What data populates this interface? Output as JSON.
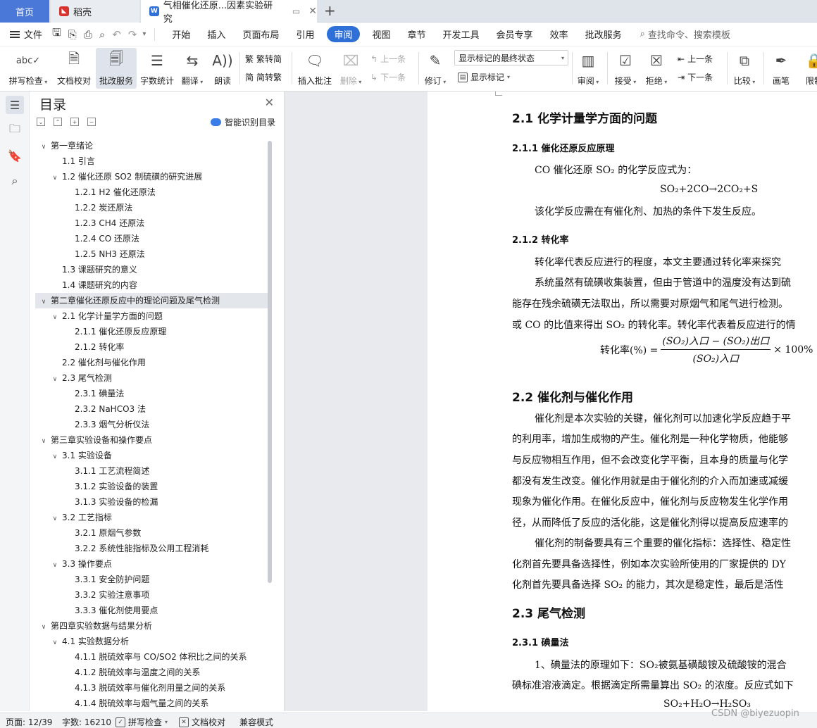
{
  "tabs": {
    "home": "首页",
    "daoke": "稻壳",
    "document": "气相催化还原...因素实验研究"
  },
  "menu": {
    "file": "文件",
    "items": [
      "开始",
      "插入",
      "页面布局",
      "引用",
      "审阅",
      "视图",
      "章节",
      "开发工具",
      "会员专享",
      "效率",
      "批改服务"
    ],
    "active_index": 4,
    "search": "查找命令、搜索模板"
  },
  "ribbon": {
    "spell_check": "拼写检查",
    "doc_proofread": "文档校对",
    "grading": "批改服务",
    "word_count": "字数统计",
    "translate": "翻译",
    "read_aloud": "朗读",
    "trad_to_simp": "繁转简",
    "simp_to_trad": "简转繁",
    "insert_comment": "插入批注",
    "delete": "删除",
    "prev_comment": "上一条",
    "next_comment": "下一条",
    "revise": "修订",
    "markup_state": "显示标记的最终状态",
    "show_markup": "显示标记",
    "review": "审阅",
    "accept": "接受",
    "reject": "拒绝",
    "prev_change": "上一条",
    "next_change": "下一条",
    "compare": "比较",
    "pen": "画笔",
    "restrict": "限制"
  },
  "toc": {
    "title": "目录",
    "smart_detect": "智能识别目录",
    "items": [
      {
        "text": "第一章绪论",
        "level": 0,
        "toggle": "expanded"
      },
      {
        "text": "1.1  引言",
        "level": 1,
        "toggle": "none"
      },
      {
        "text": "1.2  催化还原 SO2 制硫磺的研究进展",
        "level": 1,
        "toggle": "expanded"
      },
      {
        "text": "1.2.1 H2 催化还原法",
        "level": 2,
        "toggle": "none"
      },
      {
        "text": "1.2.2  炭还原法",
        "level": 2,
        "toggle": "none"
      },
      {
        "text": "1.2.3 CH4 还原法",
        "level": 2,
        "toggle": "none"
      },
      {
        "text": "1.2.4 CO 还原法",
        "level": 2,
        "toggle": "none"
      },
      {
        "text": "1.2.5 NH3 还原法",
        "level": 2,
        "toggle": "none"
      },
      {
        "text": "1.3  课题研究的意义",
        "level": 1,
        "toggle": "none"
      },
      {
        "text": "1.4  课题研究的内容",
        "level": 1,
        "toggle": "none"
      },
      {
        "text": "第二章催化还原反应中的理论问题及尾气检测",
        "level": 0,
        "toggle": "expanded",
        "selected": true
      },
      {
        "text": "2.1  化学计量学方面的问题",
        "level": 1,
        "toggle": "expanded"
      },
      {
        "text": "2.1.1  催化还原反应原理",
        "level": 2,
        "toggle": "none"
      },
      {
        "text": "2.1.2  转化率",
        "level": 2,
        "toggle": "none"
      },
      {
        "text": "2.2 催化剂与催化作用",
        "level": 1,
        "toggle": "none"
      },
      {
        "text": "2.3  尾气检测",
        "level": 1,
        "toggle": "expanded"
      },
      {
        "text": "2.3.1  碘量法",
        "level": 2,
        "toggle": "none"
      },
      {
        "text": "2.3.2 NaHCO3 法",
        "level": 2,
        "toggle": "none"
      },
      {
        "text": "2.3.3  烟气分析仪法",
        "level": 2,
        "toggle": "none"
      },
      {
        "text": "第三章实验设备和操作要点",
        "level": 0,
        "toggle": "expanded"
      },
      {
        "text": "3.1  实验设备",
        "level": 1,
        "toggle": "expanded"
      },
      {
        "text": "3.1.1  工艺流程简述",
        "level": 2,
        "toggle": "none"
      },
      {
        "text": "3.1.2  实验设备的装置",
        "level": 2,
        "toggle": "none"
      },
      {
        "text": "3.1.3  实验设备的检漏",
        "level": 2,
        "toggle": "none"
      },
      {
        "text": "3.2  工艺指标",
        "level": 1,
        "toggle": "expanded"
      },
      {
        "text": "3.2.1  原烟气参数",
        "level": 2,
        "toggle": "none"
      },
      {
        "text": "3.2.2  系统性能指标及公用工程消耗",
        "level": 2,
        "toggle": "none"
      },
      {
        "text": "3.3  操作要点",
        "level": 1,
        "toggle": "expanded"
      },
      {
        "text": "3.3.1  安全防护问题",
        "level": 2,
        "toggle": "none"
      },
      {
        "text": "3.3.2  实验注意事项",
        "level": 2,
        "toggle": "none"
      },
      {
        "text": "3.3.3  催化剂使用要点",
        "level": 2,
        "toggle": "none"
      },
      {
        "text": "第四章实验数据与结果分析",
        "level": 0,
        "toggle": "expanded"
      },
      {
        "text": "4.1  实验数据分析",
        "level": 1,
        "toggle": "expanded"
      },
      {
        "text": "4.1.1  脱硫效率与 CO/SO2 体积比之间的关系",
        "level": 2,
        "toggle": "none"
      },
      {
        "text": "4.1.2  脱硫效率与温度之间的关系",
        "level": 2,
        "toggle": "none"
      },
      {
        "text": "4.1.3  脱硫效率与催化剂用量之间的关系",
        "level": 2,
        "toggle": "none"
      },
      {
        "text": "4.1.4  脱硫效率与烟气量之间的关系",
        "level": 2,
        "toggle": "none"
      }
    ]
  },
  "doc": {
    "h_2_1": "2.1  化学计量学方面的问题",
    "h_2_1_1": "2.1.1  催化还原反应原理",
    "p1": "CO 催化还原 SO₂ 的化学反应式为：",
    "eq1": "SO₂+2CO→2CO₂+S",
    "p2": "该化学反应需在有催化剂、加热的条件下发生反应。",
    "h_2_1_2": "2.1.2  转化率",
    "p3": "转化率代表反应进行的程度，本文主要通过转化率来探究",
    "p4": "系统虽然有硫磺收集装置，但由于管道中的温度没有达到硫",
    "p5": "能存在残余硫磺无法取出，所以需要对原烟气和尾气进行检测。",
    "p6": "或 CO 的比值来得出 SO₂ 的转化率。转化率代表着反应进行的情",
    "formula_lhs": "转化率(%) =",
    "formula_num": "(SO₂)入口 − (SO₂)出口",
    "formula_den": "(SO₂)入口",
    "formula_rhs": "× 100%",
    "h_2_2": "2.2 催化剂与催化作用",
    "p7": "催化剂是本次实验的关键，催化剂可以加速化学反应趋于平",
    "p8": "的利用率，增加生成物的产生。催化剂是一种化学物质，他能够",
    "p9": "与反应物相互作用，但不会改变化学平衡，且本身的质量与化学",
    "p10": "都没有发生改变。催化作用就是由于催化剂的介入而加速或减缓",
    "p11": "现象为催化作用。在催化反应中，催化剂与反应物发生化学作用",
    "p12": "径，从而降低了反应的活化能，这是催化剂得以提高反应速率的",
    "p13": "催化剂的制备要具有三个重要的催化指标：选择性、稳定性",
    "p14": "化剂首先要具备选择性，例如本次实验所使用的厂家提供的 DY",
    "p15": "化剂首先要具备选择 SO₂ 的能力，其次是稳定性，最后是活性",
    "h_2_3": "2.3  尾气检测",
    "h_2_3_1": "2.3.1  碘量法",
    "p16": "1、碘量法的原理如下：SO₂被氨基磺酸铵及硫酸铵的混合",
    "p17": "碘标准溶液滴定。根据滴定所需量算出 SO₂ 的浓度。反应式如下",
    "eq2": "SO₂+H₂O→H₂SO₃"
  },
  "status": {
    "page": "页面: 12/39",
    "words": "字数: 16210",
    "spell": "拼写检查",
    "proof": "文档校对",
    "compat": "兼容模式"
  },
  "watermark": "CSDN @biyezuopin",
  "colors": {
    "accent": "#2f6fd8",
    "home_tab": "#4a78d8",
    "daoke_logo": "#d8322e"
  }
}
